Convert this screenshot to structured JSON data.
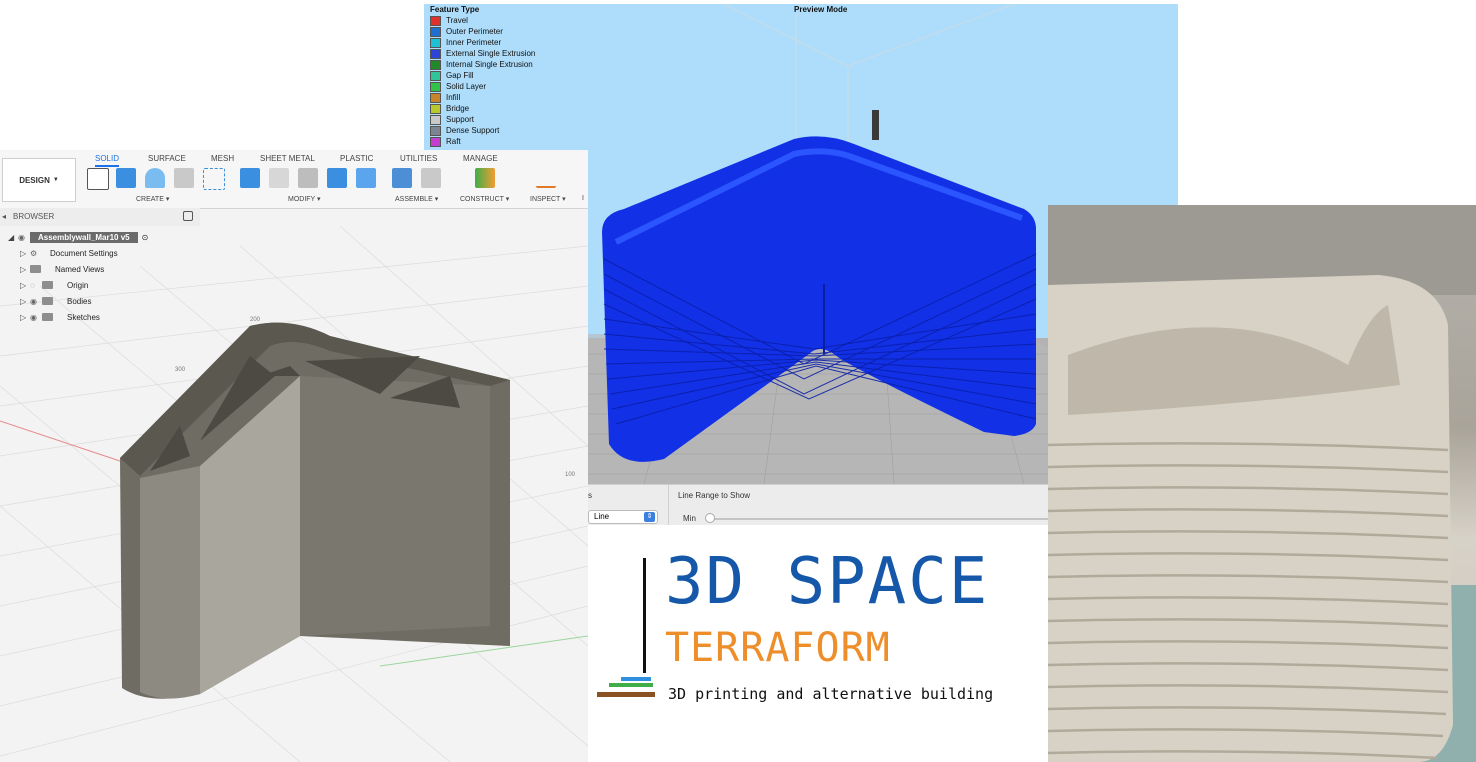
{
  "slicer": {
    "title": "Preview Mode",
    "legend_title": "Feature Type",
    "legend": [
      {
        "label": "Travel",
        "color": "#e0312f"
      },
      {
        "label": "Outer Perimeter",
        "color": "#1f6fd1"
      },
      {
        "label": "Inner Perimeter",
        "color": "#1fbfd6"
      },
      {
        "label": "External Single Extrusion",
        "color": "#2a45d8"
      },
      {
        "label": "Internal Single Extrusion",
        "color": "#208a2a"
      },
      {
        "label": "Gap Fill",
        "color": "#31c39a"
      },
      {
        "label": "Solid Layer",
        "color": "#31c24a"
      },
      {
        "label": "Infill",
        "color": "#c7842a"
      },
      {
        "label": "Bridge",
        "color": "#b9c82a"
      },
      {
        "label": "Support",
        "color": "#c9c9c9"
      },
      {
        "label": "Dense Support",
        "color": "#7c8693"
      },
      {
        "label": "Raft",
        "color": "#c33fcf"
      }
    ],
    "range_label": "Line Range to Show",
    "min_label": "Min",
    "mode_value": "Line",
    "cut_label": "s"
  },
  "fusion": {
    "design_label": "DESIGN",
    "tabs": [
      {
        "label": "SOLID",
        "active": true
      },
      {
        "label": "SURFACE"
      },
      {
        "label": "MESH"
      },
      {
        "label": "SHEET METAL"
      },
      {
        "label": "PLASTIC"
      },
      {
        "label": "UTILITIES"
      },
      {
        "label": "MANAGE"
      }
    ],
    "groups": [
      "CREATE",
      "MODIFY",
      "ASSEMBLE",
      "CONSTRUCT",
      "INSPECT",
      "I"
    ],
    "browser_label": "BROWSER",
    "root_label": "Assemblywall_Mar10 v5",
    "tree": [
      "Document Settings",
      "Named Views",
      "Origin",
      "Bodies",
      "Sketches"
    ],
    "ruler_labels": [
      "300",
      "200",
      "100"
    ]
  },
  "logo": {
    "main": "3D SPACE",
    "sub": "TERRAFORM",
    "tagline": "3D printing and alternative building"
  },
  "icons": {
    "dropdown": "chevron-down-icon",
    "eye": "eye-icon",
    "gear": "gear-icon",
    "folder": "folder-icon"
  }
}
